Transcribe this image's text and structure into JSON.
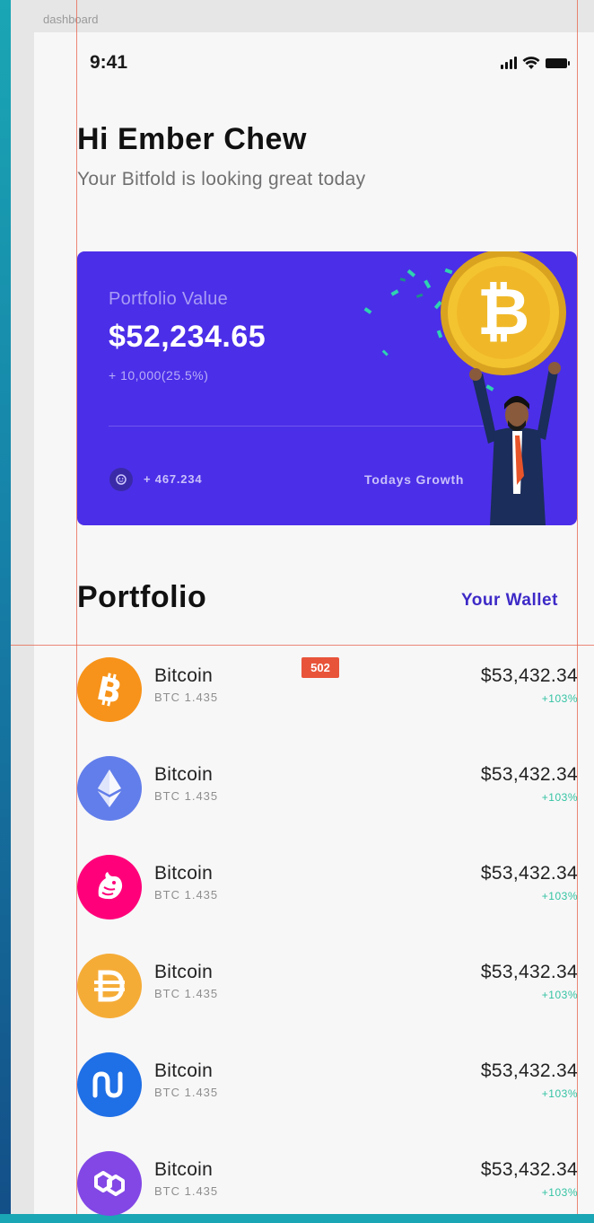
{
  "canvas": {
    "frame_label": "dashboard",
    "measure_badge": "502"
  },
  "status_bar": {
    "time": "9:41"
  },
  "header": {
    "greeting": "Hi Ember Chew",
    "subtitle": "Your Bitfold is looking great today"
  },
  "portfolio_card": {
    "label": "Portfolio Value",
    "value": "$52,234.65",
    "change": "+ 10,000(25.5%)",
    "growth_value": "+ 467.234",
    "growth_label": "Todays Growth",
    "background_color": "#4b2ee8"
  },
  "portfolio": {
    "title": "Portfolio",
    "wallet_link": "Your Wallet",
    "coins": [
      {
        "name": "Bitcoin",
        "holding": "BTC 1.435",
        "price": "$53,432.34",
        "change": "+103%",
        "icon": "bitcoin-icon",
        "color": "#f7931a"
      },
      {
        "name": "Bitcoin",
        "holding": "BTC 1.435",
        "price": "$53,432.34",
        "change": "+103%",
        "icon": "ethereum-icon",
        "color": "#627eea"
      },
      {
        "name": "Bitcoin",
        "holding": "BTC 1.435",
        "price": "$53,432.34",
        "change": "+103%",
        "icon": "uniswap-icon",
        "color": "#ff007a"
      },
      {
        "name": "Bitcoin",
        "holding": "BTC 1.435",
        "price": "$53,432.34",
        "change": "+103%",
        "icon": "dai-icon",
        "color": "#f5ac37"
      },
      {
        "name": "Bitcoin",
        "holding": "BTC 1.435",
        "price": "$53,432.34",
        "change": "+103%",
        "icon": "nano-icon",
        "color": "#1f6fe6"
      },
      {
        "name": "Bitcoin",
        "holding": "BTC 1.435",
        "price": "$53,432.34",
        "change": "+103%",
        "icon": "polygon-icon",
        "color": "#8247e5"
      }
    ],
    "change_color": "#34c3a2"
  }
}
